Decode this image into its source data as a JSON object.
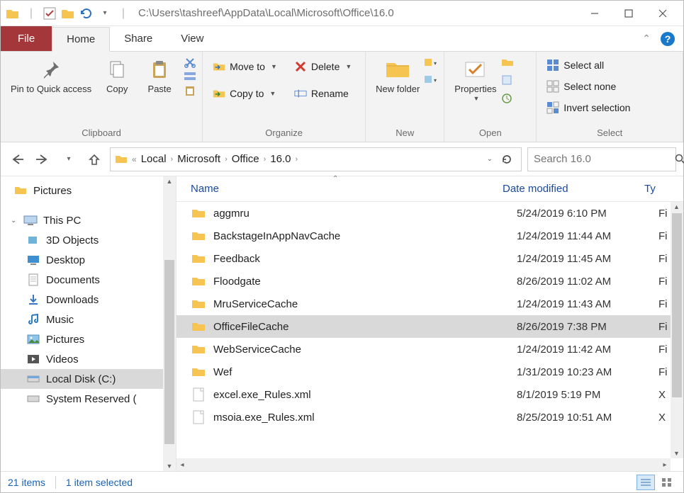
{
  "title_path": "C:\\Users\\tashreef\\AppData\\Local\\Microsoft\\Office\\16.0",
  "tabs": {
    "file": "File",
    "home": "Home",
    "share": "Share",
    "view": "View"
  },
  "ribbon": {
    "clipboard": {
      "pin": "Pin to Quick access",
      "copy": "Copy",
      "paste": "Paste",
      "label": "Clipboard"
    },
    "organize": {
      "move": "Move to",
      "copyto": "Copy to",
      "delete": "Delete",
      "rename": "Rename",
      "label": "Organize"
    },
    "new": {
      "newfolder": "New folder",
      "label": "New"
    },
    "open": {
      "properties": "Properties",
      "label": "Open"
    },
    "select": {
      "all": "Select all",
      "none": "Select none",
      "invert": "Invert selection",
      "label": "Select"
    }
  },
  "breadcrumb": [
    "Local",
    "Microsoft",
    "Office",
    "16.0"
  ],
  "search_placeholder": "Search 16.0",
  "nav": {
    "pictures": "Pictures",
    "thispc": "This PC",
    "items": [
      "3D Objects",
      "Desktop",
      "Documents",
      "Downloads",
      "Music",
      "Pictures",
      "Videos",
      "Local Disk (C:)",
      "System Reserved ("
    ]
  },
  "columns": {
    "name": "Name",
    "date": "Date modified",
    "type": "Ty"
  },
  "files": [
    {
      "name": "aggmru",
      "date": "5/24/2019 6:10 PM",
      "type": "Fi",
      "kind": "folder"
    },
    {
      "name": "BackstageInAppNavCache",
      "date": "1/24/2019 11:44 AM",
      "type": "Fi",
      "kind": "folder"
    },
    {
      "name": "Feedback",
      "date": "1/24/2019 11:45 AM",
      "type": "Fi",
      "kind": "folder"
    },
    {
      "name": "Floodgate",
      "date": "8/26/2019 11:02 AM",
      "type": "Fi",
      "kind": "folder"
    },
    {
      "name": "MruServiceCache",
      "date": "1/24/2019 11:43 AM",
      "type": "Fi",
      "kind": "folder"
    },
    {
      "name": "OfficeFileCache",
      "date": "8/26/2019 7:38 PM",
      "type": "Fi",
      "kind": "folder",
      "selected": true
    },
    {
      "name": "WebServiceCache",
      "date": "1/24/2019 11:42 AM",
      "type": "Fi",
      "kind": "folder"
    },
    {
      "name": "Wef",
      "date": "1/31/2019 10:23 AM",
      "type": "Fi",
      "kind": "folder"
    },
    {
      "name": "excel.exe_Rules.xml",
      "date": "8/1/2019 5:19 PM",
      "type": "X",
      "kind": "file"
    },
    {
      "name": "msoia.exe_Rules.xml",
      "date": "8/25/2019 10:51 AM",
      "type": "X",
      "kind": "file"
    }
  ],
  "status": {
    "count": "21 items",
    "selection": "1 item selected"
  }
}
